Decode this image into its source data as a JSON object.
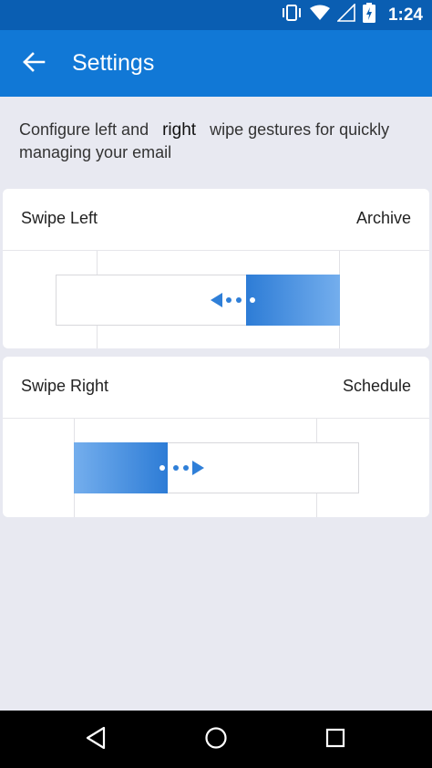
{
  "status_bar": {
    "time": "1:24",
    "icons": [
      "vibrate-icon",
      "wifi-icon",
      "signal-icon",
      "battery-charging-icon"
    ]
  },
  "app_bar": {
    "title": "Settings",
    "back_icon": "arrow-left-icon"
  },
  "description": {
    "part1": "Configure left and",
    "emphasis": "right",
    "part2": "wipe gestures for quickly managing your email"
  },
  "swipe_left": {
    "label": "Swipe Left",
    "action": "Archive",
    "direction": "left"
  },
  "swipe_right": {
    "label": "Swipe Right",
    "action": "Schedule",
    "direction": "right"
  },
  "colors": {
    "status_bar": "#0a5eb2",
    "app_bar": "#1178d6",
    "accent": "#2f7fd8",
    "background": "#e8e9f1"
  },
  "nav_bar": {
    "buttons": [
      "back-triangle-icon",
      "home-circle-icon",
      "recents-square-icon"
    ]
  }
}
